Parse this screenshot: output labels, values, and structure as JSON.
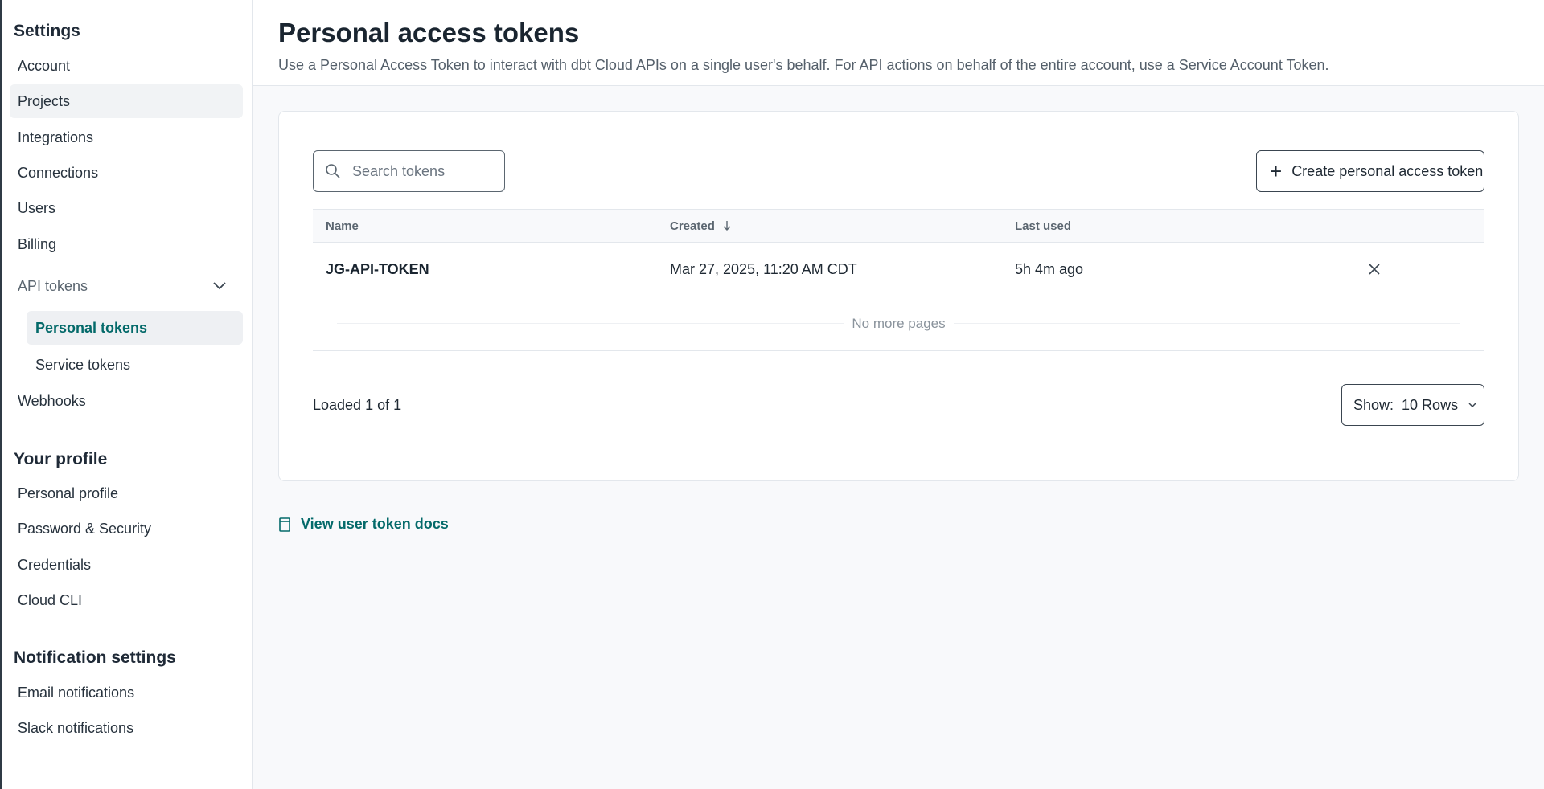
{
  "sidebar": {
    "settings_title": "Settings",
    "settings_items": [
      {
        "label": "Account"
      },
      {
        "label": "Projects"
      },
      {
        "label": "Integrations"
      },
      {
        "label": "Connections"
      },
      {
        "label": "Users"
      },
      {
        "label": "Billing"
      }
    ],
    "api_tokens": {
      "label": "API tokens",
      "children": [
        {
          "label": "Personal tokens"
        },
        {
          "label": "Service tokens"
        }
      ]
    },
    "webhooks_label": "Webhooks",
    "profile_title": "Your profile",
    "profile_items": [
      {
        "label": "Personal profile"
      },
      {
        "label": "Password & Security"
      },
      {
        "label": "Credentials"
      },
      {
        "label": "Cloud CLI"
      }
    ],
    "notification_title": "Notification settings",
    "notification_items": [
      {
        "label": "Email notifications"
      },
      {
        "label": "Slack notifications"
      }
    ]
  },
  "header": {
    "title": "Personal access tokens",
    "subtitle": "Use a Personal Access Token to interact with dbt Cloud APIs on a single user's behalf. For API actions on behalf of the entire account, use a Service Account Token."
  },
  "toolbar": {
    "search_placeholder": "Search tokens",
    "create_label": "Create personal access token"
  },
  "table": {
    "columns": {
      "name": "Name",
      "created": "Created",
      "last_used": "Last used"
    },
    "rows": [
      {
        "name": "JG-API-TOKEN",
        "created": "Mar 27, 2025, 11:20 AM CDT",
        "last_used": "5h 4m ago"
      }
    ],
    "no_more_pages": "No more pages"
  },
  "footer": {
    "loaded_text": "Loaded 1 of 1",
    "show_label": "Show:",
    "rows_value": "10 Rows"
  },
  "docs_link": "View user token docs",
  "colors": {
    "accent": "#046a6a",
    "border": "#e3e7ec"
  }
}
